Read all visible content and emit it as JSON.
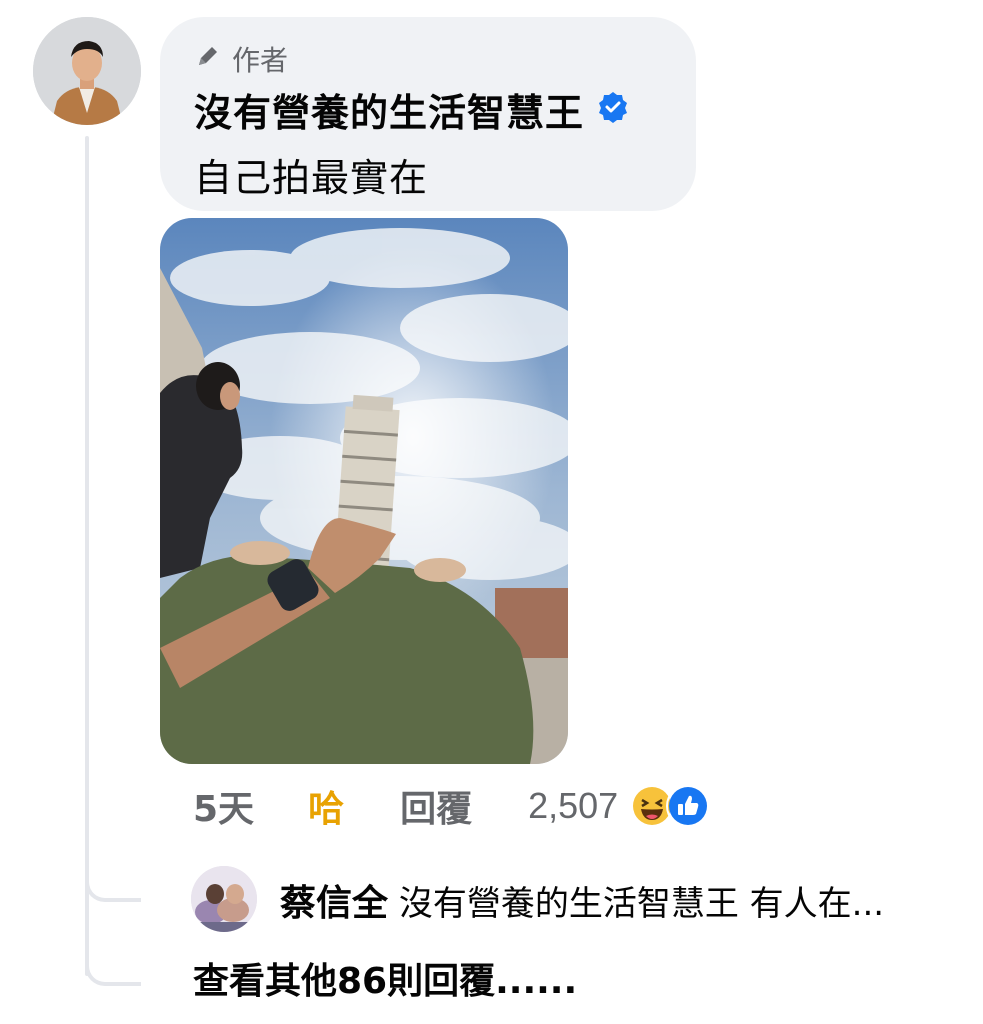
{
  "comment": {
    "badge_label": "作者",
    "author_name": "沒有營養的生活智慧王",
    "text": "自己拍最實在"
  },
  "actions": {
    "time": "5天",
    "reaction_label": "哈",
    "reply_label": "回覆",
    "reaction_count": "2,507"
  },
  "reply_preview": {
    "name": "蔡信全",
    "text": "沒有營養的生活智慧王 有人在..."
  },
  "more_replies": "查看其他86則回覆......",
  "colors": {
    "verified": "#1877f2",
    "haha_active": "#e8a202",
    "bubble_bg": "#f0f2f5"
  },
  "icons": [
    "pen-icon",
    "verified-icon",
    "haha-reaction-icon",
    "like-reaction-icon"
  ]
}
